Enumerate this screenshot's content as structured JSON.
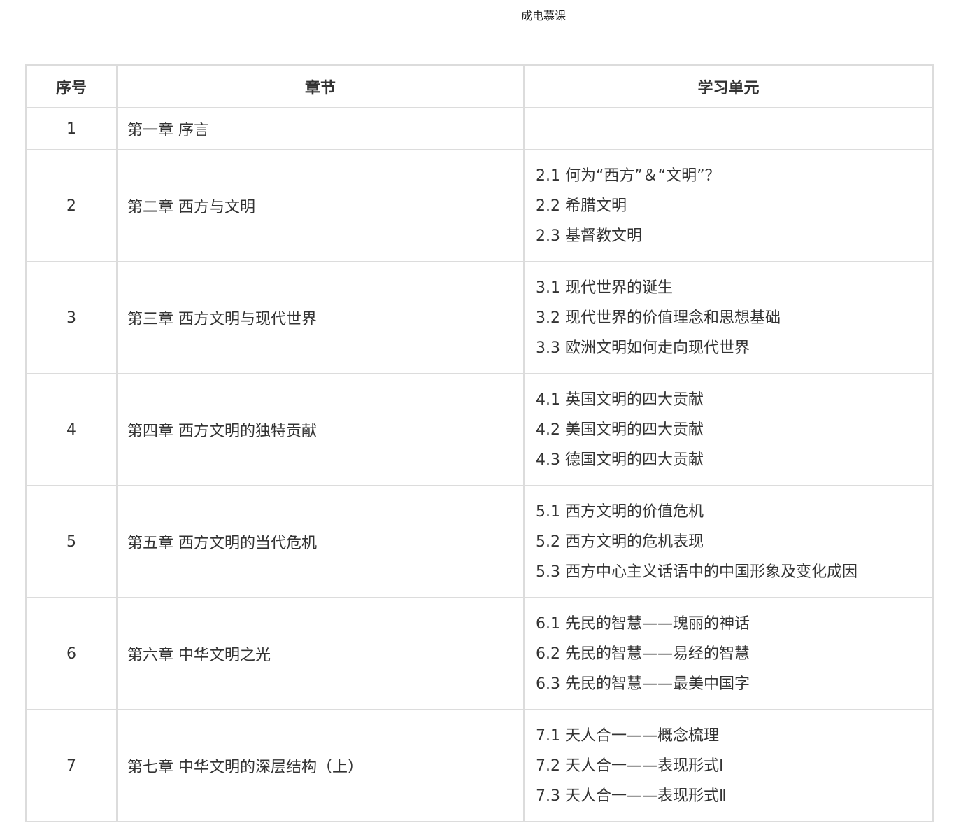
{
  "header": {
    "title": "成电慕课"
  },
  "table": {
    "columns": [
      "序号",
      "章节",
      "学习单元"
    ],
    "rows": [
      {
        "index": "1",
        "chapter": "第一章 序言",
        "units": []
      },
      {
        "index": "2",
        "chapter": "第二章 西方与文明",
        "units": [
          "2.1 何为“西方”＆“文明”？",
          "2.2 希腊文明",
          "2.3 基督教文明"
        ]
      },
      {
        "index": "3",
        "chapter": "第三章 西方文明与现代世界",
        "units": [
          "3.1 现代世界的诞生",
          "3.2 现代世界的价值理念和思想基础",
          "3.3 欧洲文明如何走向现代世界"
        ]
      },
      {
        "index": "4",
        "chapter": "第四章 西方文明的独特贡献",
        "units": [
          "4.1 英国文明的四大贡献",
          "4.2 美国文明的四大贡献",
          "4.3 德国文明的四大贡献"
        ]
      },
      {
        "index": "5",
        "chapter": "第五章 西方文明的当代危机",
        "units": [
          "5.1 西方文明的价值危机",
          "5.2 西方文明的危机表现",
          "5.3 西方中心主义话语中的中国形象及变化成因"
        ]
      },
      {
        "index": "6",
        "chapter": "第六章 中华文明之光",
        "units": [
          "6.1 先民的智慧——瑰丽的神话",
          "6.2 先民的智慧——易经的智慧",
          "6.3 先民的智慧——最美中国字"
        ]
      },
      {
        "index": "7",
        "chapter": "第七章 中华文明的深层结构（上）",
        "units": [
          "7.1 天人合一——概念梳理",
          "7.2 天人合一——表现形式Ⅰ",
          "7.3 天人合一——表现形式Ⅱ"
        ]
      }
    ]
  }
}
